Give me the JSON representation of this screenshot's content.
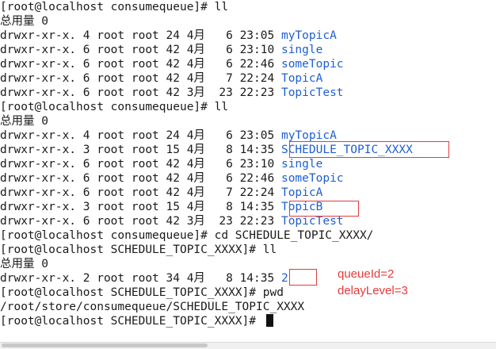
{
  "terminal": {
    "lines": [
      {
        "text": "[root@localhost consumequeue]# ll"
      },
      {
        "text": "总用量 0"
      },
      {
        "text": "drwxr-xr-x. 4 root root 24 4月   6 23:05 ",
        "dir": "myTopicA"
      },
      {
        "text": "drwxr-xr-x. 6 root root 42 4月   6 23:10 ",
        "dir": "single"
      },
      {
        "text": "drwxr-xr-x. 6 root root 42 4月   6 22:46 ",
        "dir": "someTopic"
      },
      {
        "text": "drwxr-xr-x. 6 root root 42 4月   7 22:24 ",
        "dir": "TopicA"
      },
      {
        "text": "drwxr-xr-x. 6 root root 42 3月  23 22:23 ",
        "dir": "TopicTest"
      },
      {
        "text": "[root@localhost consumequeue]# ll"
      },
      {
        "text": "总用量 0"
      },
      {
        "text": "drwxr-xr-x. 4 root root 24 4月   6 23:05 ",
        "dir": "myTopicA"
      },
      {
        "text": "drwxr-xr-x. 3 root root 15 4月   8 14:35 ",
        "dir": "SCHEDULE_TOPIC_XXXX"
      },
      {
        "text": "drwxr-xr-x. 6 root root 42 4月   6 23:10 ",
        "dir": "single"
      },
      {
        "text": "drwxr-xr-x. 6 root root 42 4月   6 22:46 ",
        "dir": "someTopic"
      },
      {
        "text": "drwxr-xr-x. 6 root root 42 4月   7 22:24 ",
        "dir": "TopicA"
      },
      {
        "text": "drwxr-xr-x. 3 root root 15 4月   8 14:35 ",
        "dir": "TopicB"
      },
      {
        "text": "drwxr-xr-x. 6 root root 42 3月  23 22:23 ",
        "dir": "TopicTest"
      },
      {
        "text": "[root@localhost consumequeue]# cd SCHEDULE_TOPIC_XXXX/"
      },
      {
        "text": "[root@localhost SCHEDULE_TOPIC_XXXX]# ll"
      },
      {
        "text": "总用量 0"
      },
      {
        "text": "drwxr-xr-x. 2 root root 34 4月   8 14:35 ",
        "dir": "2"
      },
      {
        "text": "[root@localhost SCHEDULE_TOPIC_XXXX]# pwd"
      },
      {
        "text": "/root/store/consumequeue/SCHEDULE_TOPIC_XXXX"
      },
      {
        "text": "[root@localhost SCHEDULE_TOPIC_XXXX]# ",
        "cursor": true
      }
    ]
  },
  "annotations": {
    "queue_id": "queueId=2",
    "delay_level": "delayLevel=3"
  },
  "colors": {
    "directory": "#1f5fd0",
    "highlight": "#e23b3b",
    "text": "#1a1a1a"
  }
}
